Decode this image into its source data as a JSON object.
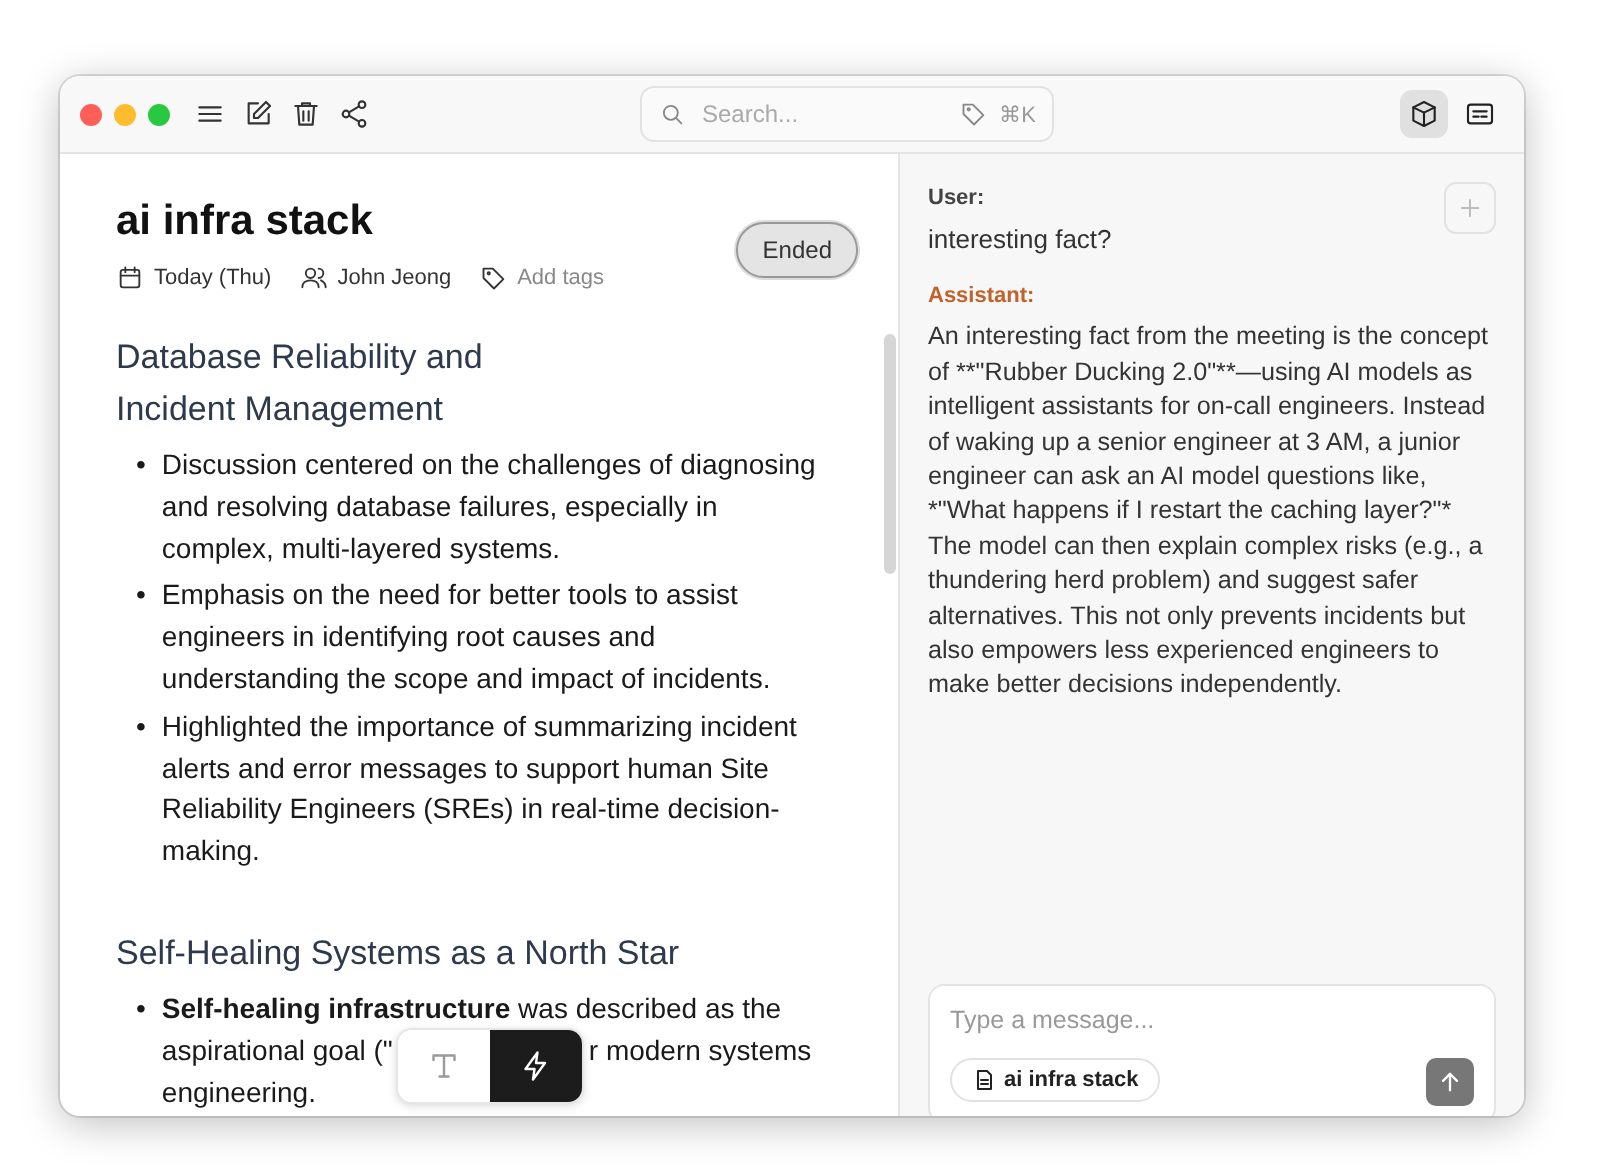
{
  "toolbar": {
    "search": {
      "placeholder": "Search...",
      "shortcut": "⌘K"
    },
    "view_buttons": [
      {
        "kind": "cube",
        "selected": true
      },
      {
        "kind": "card",
        "selected": false
      }
    ]
  },
  "note": {
    "title": "ai infra stack",
    "date": "Today (Thu)",
    "participant": "John Jeong",
    "tags_placeholder": "Add tags",
    "status": "Ended",
    "sections": [
      {
        "heading": "Database Reliability and Incident Management",
        "bullets": [
          {
            "marker": "•",
            "text": "Discussion centered on the challenges of diagnosing and resolving database failures, especially in complex, multi-layered systems."
          },
          {
            "marker": "•",
            "text": "Emphasis on the need for better tools to assist engineers in identifying root causes and understanding the scope and impact of incidents."
          },
          {
            "marker": "•",
            "text": "Highlighted the importance of summarizing incident alerts and error messages to support human Site Reliability Engineers (SREs) in real-time decision-making."
          }
        ]
      },
      {
        "heading": "Self-Healing Systems as a North Star",
        "bullets": [
          {
            "marker": "•",
            "text": "**Self-healing infrastructure** was described as the",
            "text_before_overlay": "aspirational goal (\"",
            "text_after_overlay": "r modern systems",
            "text_end": "engineering."
          }
        ]
      }
    ]
  },
  "floating_toolbar": [
    {
      "kind": "text",
      "selected": false
    },
    {
      "kind": "bolt",
      "selected": true
    }
  ],
  "chat": {
    "messages": [
      {
        "kind": "user",
        "label": "User:",
        "text": "interesting fact?"
      },
      {
        "kind": "assistant",
        "label": "Assistant:",
        "text": "An interesting fact from the meeting is the concept of **\"Rubber Ducking 2.0\"**—using AI models as intelligent assistants for on-call engineers. Instead of waking up a senior engineer at 3 AM, a junior engineer can ask an AI model questions like, *\"What happens if I restart the caching layer?\"* The model can then explain complex risks (e.g., a thundering herd problem) and suggest safer alternatives. This not only prevents incidents but also empowers less experienced engineers to make better decisions independently."
      }
    ],
    "composer": {
      "placeholder": "Type a message...",
      "attachment": "ai infra stack"
    }
  }
}
